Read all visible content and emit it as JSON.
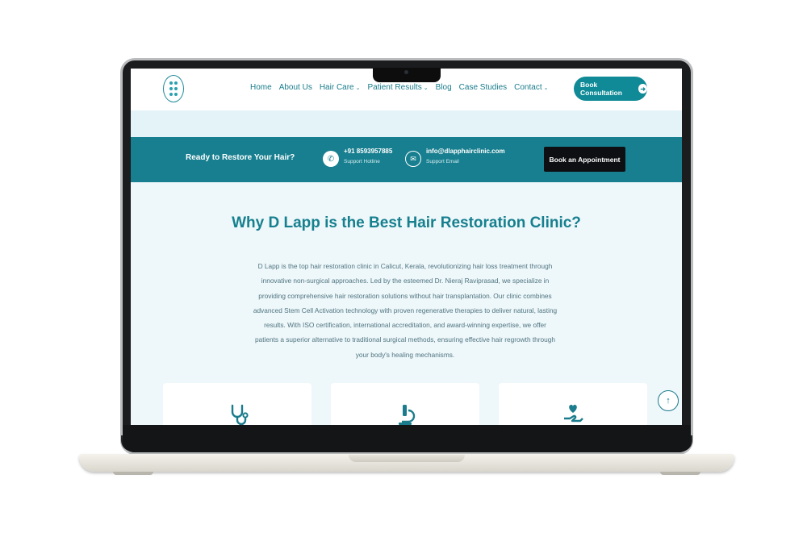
{
  "nav": {
    "links": [
      {
        "label": "Home",
        "dropdown": false
      },
      {
        "label": "About Us",
        "dropdown": false
      },
      {
        "label": "Hair Care",
        "dropdown": true
      },
      {
        "label": "Patient Results",
        "dropdown": true
      },
      {
        "label": "Blog",
        "dropdown": false
      },
      {
        "label": "Case Studies",
        "dropdown": false
      },
      {
        "label": "Contact",
        "dropdown": true
      }
    ],
    "cta_label": "Book Consultation"
  },
  "infobar": {
    "tagline": "Ready to Restore Your Hair?",
    "phone": {
      "value": "+91 8593957885",
      "caption": "Support Hotline"
    },
    "email": {
      "value": "info@dlapphairclinic.com",
      "caption": "Support Email"
    },
    "appointment_label": "Book an Appointment"
  },
  "content": {
    "headline": "Why D Lapp is the Best Hair Restoration Clinic?",
    "paragraph": "D Lapp is the top hair restoration clinic in Calicut, Kerala, revolutionizing hair loss treatment through innovative non-surgical approaches. Led by the esteemed Dr. Nieraj Raviprasad, we specialize in providing comprehensive hair restoration solutions without hair transplantation. Our clinic combines advanced Stem Cell Activation technology with proven regenerative therapies to deliver natural, lasting results. With ISO certification, international accreditation, and award-winning expertise, we offer patients a superior alternative to traditional surgical methods, ensuring effective hair regrowth through your body's healing mechanisms."
  },
  "cards": [
    {
      "icon": "stethoscope-icon"
    },
    {
      "icon": "microscope-icon"
    },
    {
      "icon": "hand-heart-icon"
    }
  ],
  "colors": {
    "primary": "#177f8f",
    "accent": "#0f8a96",
    "text_teal": "#16808f",
    "background": "#eef7fa",
    "dark_button": "#0d0f12"
  }
}
